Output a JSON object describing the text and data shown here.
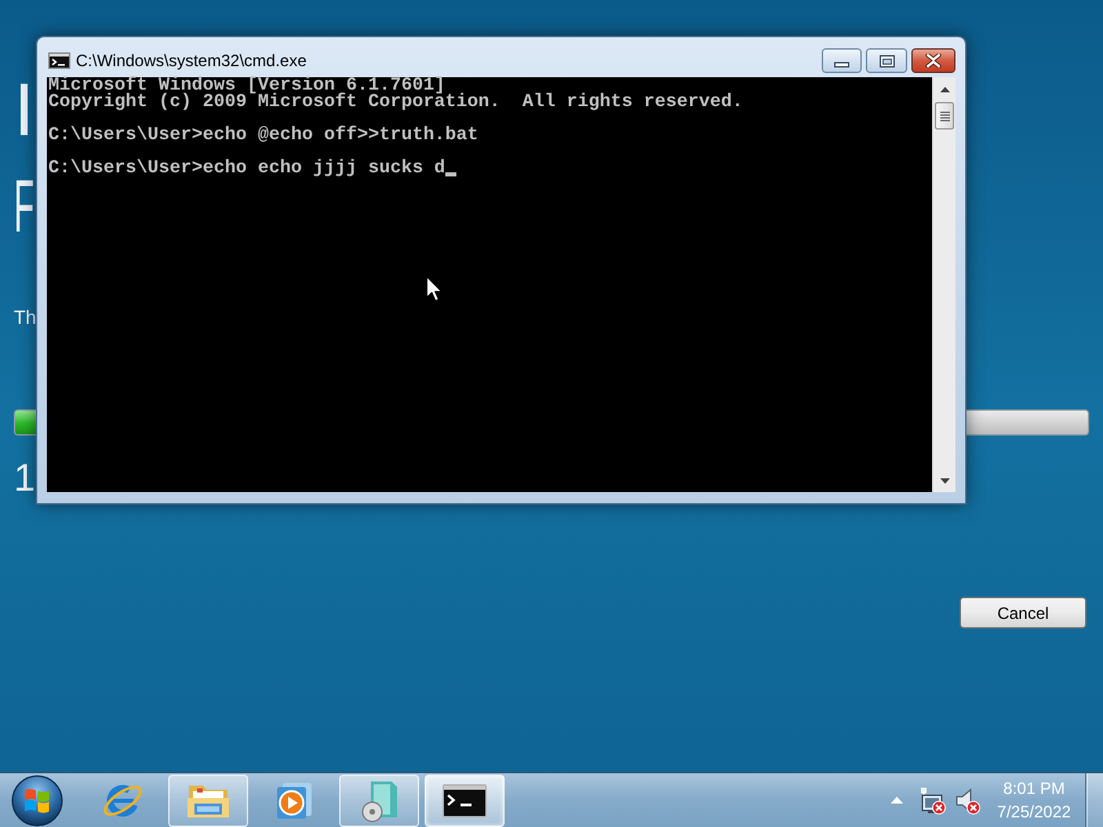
{
  "setup_screen": {
    "heading": "I",
    "subheading": "F",
    "paragraph": "Th",
    "caption": "1",
    "cancel_button": "Cancel"
  },
  "console_window": {
    "title": "C:\\Windows\\system32\\cmd.exe",
    "blocks": [
      [
        "Microsoft Windows [Version 6.1.7601]",
        "Copyright (c) 2009 Microsoft Corporation.  All rights reserved."
      ],
      [
        "C:\\Users\\User>echo @echo off>>truth.bat"
      ],
      [
        "C:\\Users\\User>echo echo jjjj sucks d"
      ]
    ]
  },
  "taskbar": {
    "items": [
      {
        "kind": "browser",
        "running": false,
        "selected": false
      },
      {
        "kind": "folder",
        "running": true,
        "selected": false
      },
      {
        "kind": "player",
        "running": false,
        "selected": false
      },
      {
        "kind": "transfer",
        "running": true,
        "selected": false
      },
      {
        "kind": "terminal",
        "running": true,
        "selected": true
      }
    ],
    "tray_icons": [
      {
        "kind": "network",
        "alert": true
      },
      {
        "kind": "volume",
        "alert": true
      }
    ],
    "clock": {
      "time": "8:01 PM",
      "date": "7/25/2022"
    }
  }
}
